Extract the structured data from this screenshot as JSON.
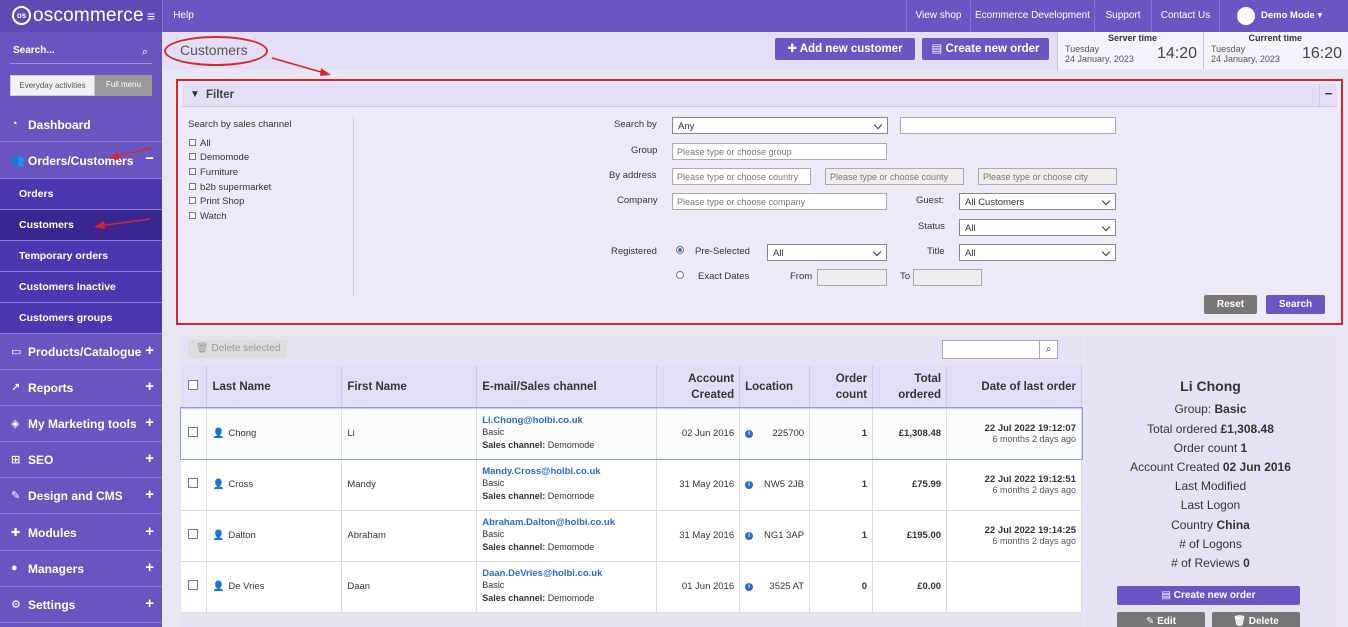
{
  "brand": "oscommerce",
  "sidebar": {
    "search_placeholder": "Search...",
    "mode_everyday": "Everyday activities",
    "mode_full": "Full menu",
    "items": [
      {
        "label": "Dashboard"
      },
      {
        "label": "Orders/Customers",
        "sign": "−"
      },
      {
        "label": "Products/Catalogue",
        "sign": "+"
      },
      {
        "label": "Reports",
        "sign": "+"
      },
      {
        "label": "My Marketing tools",
        "sign": "+"
      },
      {
        "label": "SEO",
        "sign": "+"
      },
      {
        "label": "Design and CMS",
        "sign": "+"
      },
      {
        "label": "Modules",
        "sign": "+"
      },
      {
        "label": "Managers",
        "sign": "+"
      },
      {
        "label": "Settings",
        "sign": "+"
      }
    ],
    "sub_items": [
      "Orders",
      "Customers",
      "Temporary orders",
      "Customers Inactive",
      "Customers groups"
    ]
  },
  "topbar": {
    "help": "Help",
    "view_shop": "View shop",
    "ecom_dev": "Ecommerce Development",
    "support": "Support",
    "contact": "Contact Us",
    "user": "Demo Mode ▾"
  },
  "header": {
    "title": "Customers",
    "add_customer": "Add new customer",
    "create_order": "Create new order",
    "server_time_label": "Server time",
    "server_day": "Tuesday",
    "server_date": "24 January, 2023",
    "server_time": "14:20",
    "current_time_label": "Current time",
    "current_day": "Tuesday",
    "current_date": "24 January, 2023",
    "current_time": "16:20"
  },
  "filter": {
    "title": "Filter",
    "minimize": "−",
    "channel_label": "Search by sales channel",
    "channels": [
      "All",
      "Demomode",
      "Furniture",
      "b2b supermarket",
      "Print Shop",
      "Watch"
    ],
    "search_by_label": "Search by",
    "search_by_value": "Any",
    "group_label": "Group",
    "group_placeholder": "Please type or choose group",
    "address_label": "By address",
    "country_placeholder": "Please type or choose country",
    "county_placeholder": "Please type or choose county",
    "city_placeholder": "Please type or choose city",
    "company_label": "Company",
    "company_placeholder": "Please type or choose company",
    "guest_label": "Guest:",
    "guest_value": "All Customers",
    "status_label": "Status",
    "status_value": "All",
    "registered_label": "Registered",
    "preselected_label": "Pre-Selected",
    "preselected_value": "All",
    "title_label": "Title",
    "title_value": "All",
    "exact_dates_label": "Exact Dates",
    "from_label": "From",
    "to_label": "To",
    "reset": "Reset",
    "search": "Search"
  },
  "table": {
    "delete_selected": "Delete selected",
    "headers": [
      "Last Name",
      "First Name",
      "E-mail/Sales channel",
      "Account Created",
      "Location",
      "Order count",
      "Total ordered",
      "Date of last order"
    ],
    "rows": [
      {
        "last": "Chong",
        "first": "Li",
        "email": "Li.Chong@holbi.co.uk",
        "group": "Basic",
        "channel_label": "Sales channel:",
        "channel": "Demomode",
        "created": "02 Jun 2016",
        "location": "225700",
        "count": "1",
        "total": "£1,308.48",
        "last_order": "22 Jul 2022 19:12:07",
        "ago": "6 months 2 days ago"
      },
      {
        "last": "Cross",
        "first": "Mandy",
        "email": "Mandy.Cross@holbi.co.uk",
        "group": "Basic",
        "channel_label": "Sales channel:",
        "channel": "Demomode",
        "created": "31 May 2016",
        "location": "NW5 2JB",
        "count": "1",
        "total": "£75.99",
        "last_order": "22 Jul 2022 19:12:51",
        "ago": "6 months 2 days ago"
      },
      {
        "last": "Dalton",
        "first": "Abraham",
        "email": "Abraham.Dalton@holbi.co.uk",
        "group": "Basic",
        "channel_label": "Sales channel:",
        "channel": "Demomode",
        "created": "31 May 2016",
        "location": "NG1 3AP",
        "count": "1",
        "total": "£195.00",
        "last_order": "22 Jul 2022 19:14:25",
        "ago": "6 months 2 days ago"
      },
      {
        "last": "De Vries",
        "first": "Daan",
        "email": "Daan.DeVries@holbi.co.uk",
        "group": "Basic",
        "channel_label": "Sales channel:",
        "channel": "Demomode",
        "created": "01 Jun 2016",
        "location": "3525 AT",
        "count": "0",
        "total": "£0.00",
        "last_order": "",
        "ago": ""
      }
    ]
  },
  "detail": {
    "name": "Li Chong",
    "group_label": "Group:",
    "group": "Basic",
    "total_label": "Total ordered",
    "total": "£1,308.48",
    "count_label": "Order count",
    "count": "1",
    "created_label": "Account Created",
    "created": "02 Jun 2016",
    "modified_label": "Last Modified",
    "logon_label": "Last Logon",
    "country_label": "Country",
    "country": "China",
    "logons_label": "# of Logons",
    "reviews_label": "# of Reviews",
    "reviews": "0",
    "create_order": "Create new order",
    "edit": "Edit",
    "delete": "Delete"
  }
}
